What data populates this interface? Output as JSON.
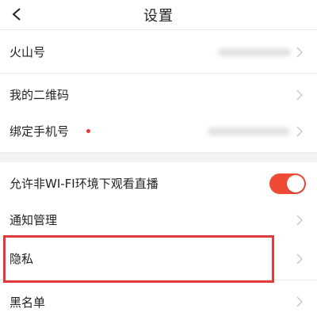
{
  "header": {
    "title": "设置",
    "back_icon": "chevron-left-icon"
  },
  "rows": {
    "huoshan_id": {
      "label": "火山号"
    },
    "qr_code": {
      "label": "我的二维码"
    },
    "bind_phone": {
      "label": "绑定手机号"
    },
    "wifi_live": {
      "label": "允许非WI-FI环境下观看直播",
      "toggle_on": true
    },
    "notifications": {
      "label": "通知管理"
    },
    "privacy": {
      "label": "隐私"
    },
    "blacklist": {
      "label": "黑名单"
    }
  },
  "colors": {
    "accent": "#f04a37",
    "highlight": "#e23a3a",
    "dot": "#e53935",
    "divider": "#ececec",
    "section_gap": "#f2f2f2"
  }
}
